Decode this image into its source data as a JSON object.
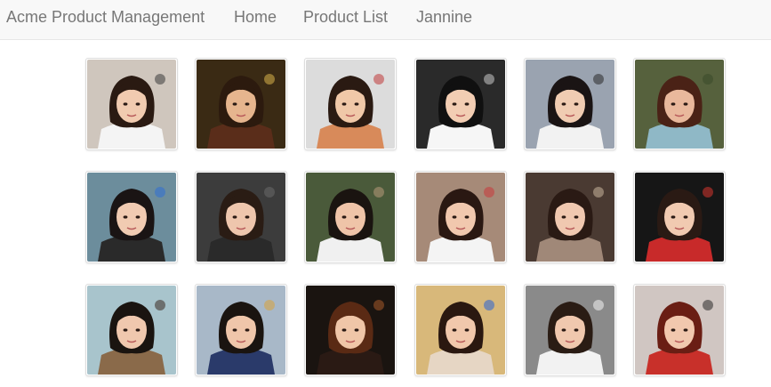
{
  "navbar": {
    "brand": "Acme Product Management",
    "links": [
      "Home",
      "Product List",
      "Jannine"
    ]
  },
  "gallery": {
    "photos": [
      {
        "name": "photo-1-1",
        "bg": "#cfc6bd",
        "hair": "#2a1a12",
        "skin": "#f1cbb0",
        "cloth": "#f4f4f4",
        "accent": "#3a3a3a"
      },
      {
        "name": "photo-1-2",
        "bg": "#3a2a14",
        "hair": "#2c1a0e",
        "skin": "#e6b58e",
        "cloth": "#5a2d1a",
        "accent": "#d9b24a"
      },
      {
        "name": "photo-1-3",
        "bg": "#dcdcdc",
        "hair": "#2a1a12",
        "skin": "#f0c8a8",
        "cloth": "#d88a5a",
        "accent": "#c03838"
      },
      {
        "name": "photo-1-4",
        "bg": "#2a2a2a",
        "hair": "#101010",
        "skin": "#f2cdb3",
        "cloth": "#f6f6f6",
        "accent": "#c8c8c8"
      },
      {
        "name": "photo-1-5",
        "bg": "#9aa3b0",
        "hair": "#1a1414",
        "skin": "#f0ccb2",
        "cloth": "#f2f2f2",
        "accent": "#2a2a2a"
      },
      {
        "name": "photo-1-6",
        "bg": "#56613d",
        "hair": "#4a2216",
        "skin": "#e9b89c",
        "cloth": "#8fb8c6",
        "accent": "#3a4a2a"
      },
      {
        "name": "photo-2-1",
        "bg": "#6c8d9c",
        "hair": "#1a1414",
        "skin": "#f1cbb2",
        "cloth": "#2a2a2a",
        "accent": "#2f6fd6"
      },
      {
        "name": "photo-2-2",
        "bg": "#3c3c3c",
        "hair": "#2a1c14",
        "skin": "#eec6ad",
        "cloth": "#2a2a2a",
        "accent": "#6a6a6a"
      },
      {
        "name": "photo-2-3",
        "bg": "#4a5a3a",
        "hair": "#1a1410",
        "skin": "#efc4a8",
        "cloth": "#f0f0f0",
        "accent": "#b89a7a"
      },
      {
        "name": "photo-2-4",
        "bg": "#a68a78",
        "hair": "#2a1812",
        "skin": "#f1c8ae",
        "cloth": "#f4f4f4",
        "accent": "#c8383a"
      },
      {
        "name": "photo-2-5",
        "bg": "#4a3a32",
        "hair": "#2a1a14",
        "skin": "#f0c8b0",
        "cloth": "#a08878",
        "accent": "#c8b49c"
      },
      {
        "name": "photo-2-6",
        "bg": "#161616",
        "hair": "#2a1a14",
        "skin": "#f1cab1",
        "cloth": "#c82a2a",
        "accent": "#d8362f"
      },
      {
        "name": "photo-3-1",
        "bg": "#a8c4cc",
        "hair": "#1a1410",
        "skin": "#f0c8ae",
        "cloth": "#8a6a4a",
        "accent": "#3a2a20"
      },
      {
        "name": "photo-3-2",
        "bg": "#a8b8c8",
        "hair": "#1a1410",
        "skin": "#efc6aa",
        "cloth": "#2a3a6a",
        "accent": "#d8a23a"
      },
      {
        "name": "photo-3-3",
        "bg": "#1a1410",
        "hair": "#5a2a14",
        "skin": "#f0c6a8",
        "cloth": "#2a1a14",
        "accent": "#a85a2a"
      },
      {
        "name": "photo-3-4",
        "bg": "#d8b87a",
        "hair": "#2a1810",
        "skin": "#f1c8ac",
        "cloth": "#e6d6c4",
        "accent": "#2a62d6"
      },
      {
        "name": "photo-3-5",
        "bg": "#8a8a8a",
        "hair": "#2a1c14",
        "skin": "#f0c8ae",
        "cloth": "#f2f2f2",
        "accent": "#f4f4f4"
      },
      {
        "name": "photo-3-6",
        "bg": "#d0c6c2",
        "hair": "#6a1e14",
        "skin": "#f1c8ae",
        "cloth": "#c8302a",
        "accent": "#2a2a2a"
      }
    ]
  }
}
